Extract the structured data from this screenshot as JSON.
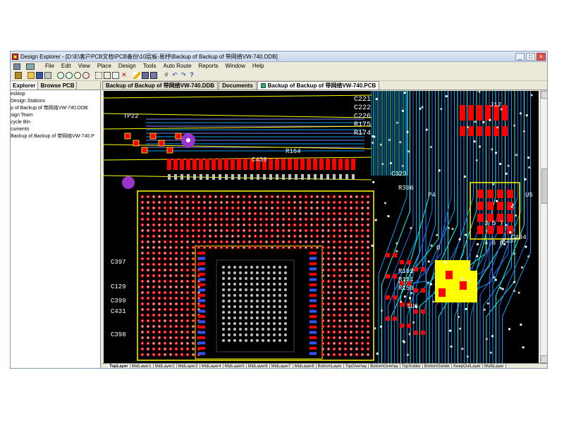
{
  "window": {
    "title": "Design Explorer - [D:\\E\\客户PCB文档\\PCB备份\\10层板-易杼\\Backup of Backup of 带网络VW-740.DDB]"
  },
  "menu": {
    "items": [
      "File",
      "Edit",
      "View",
      "Place",
      "Design",
      "Tools",
      "Auto Route",
      "Reports",
      "Window",
      "Help"
    ]
  },
  "panel": {
    "tabs": [
      "Explorer",
      "Browse PCB"
    ],
    "tree": [
      "esktop",
      " Design Stations",
      "p of Backup of 带网络VW-740.DDB",
      "sign Team",
      "cycle Bin",
      "cuments",
      " Backup of Backup of 带网络VW-740.P"
    ]
  },
  "docs": {
    "tabs": [
      "Backup of Backup of 带网络VW-740.DDB",
      "Documents",
      "Backup of Backup of 带网络VW-740.PCB"
    ]
  },
  "layers": [
    "TopLayer",
    "MidLayer1",
    "MidLayer2",
    "MidLayer3",
    "MidLayer4",
    "MidLayer5",
    "MidLayer6",
    "MidLayer7",
    "MidLayer8",
    "BottomLayer",
    "TopOverlay",
    "BottomOverlay",
    "TopSolder",
    "BottomSolder",
    "KeepOutLayer",
    "MultiLayer"
  ],
  "pcb": {
    "labels": [
      "C221",
      "C222",
      "C226",
      "R175",
      "R174",
      "TP22",
      "R164",
      "C397",
      "C129",
      "C399",
      "C431",
      "C398",
      "C439",
      "J12",
      "P4",
      "U5",
      "1U5",
      "R152",
      "R151",
      "R150",
      "C323",
      "R306",
      "C484",
      "R237",
      "D",
      "3 5 7",
      "4 6 8"
    ],
    "colors": {
      "background": "#000000",
      "top": "#ff0000",
      "overlay": "#ffff00",
      "mid1": "#00a0ff",
      "mid2": "#00ffff",
      "pads": "#c0c0c0",
      "vias": "#ffffff"
    }
  }
}
